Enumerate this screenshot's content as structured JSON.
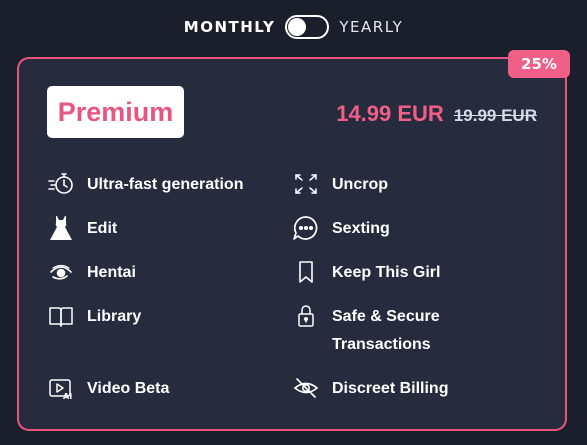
{
  "billing_toggle": {
    "monthly_label": "MONTHLY",
    "yearly_label": "YEARLY",
    "selected": "monthly"
  },
  "plan": {
    "discount_badge": "25%",
    "name": "Premium",
    "price_current": "14.99 EUR",
    "price_original": "19.99 EUR"
  },
  "features_left": [
    {
      "label": "Ultra-fast generation",
      "icon": "stopwatch-icon"
    },
    {
      "label": "Edit",
      "icon": "dress-icon"
    },
    {
      "label": "Hentai",
      "icon": "eye-icon"
    },
    {
      "label": "Library",
      "icon": "book-icon"
    },
    {
      "label": "Video Beta",
      "icon": "video-ai-icon"
    }
  ],
  "features_right": [
    {
      "label": "Uncrop",
      "icon": "expand-icon"
    },
    {
      "label": "Sexting",
      "icon": "chat-bubble-icon"
    },
    {
      "label": "Keep This Girl",
      "icon": "bookmark-icon"
    },
    {
      "label": "Safe & Secure Transactions",
      "icon": "lock-icon"
    },
    {
      "label": "Discreet Billing",
      "icon": "eye-off-icon"
    }
  ],
  "colors": {
    "background": "#1b1f2b",
    "card": "#262c3e",
    "accent": "#e8557e",
    "badge": "#f05f88"
  }
}
